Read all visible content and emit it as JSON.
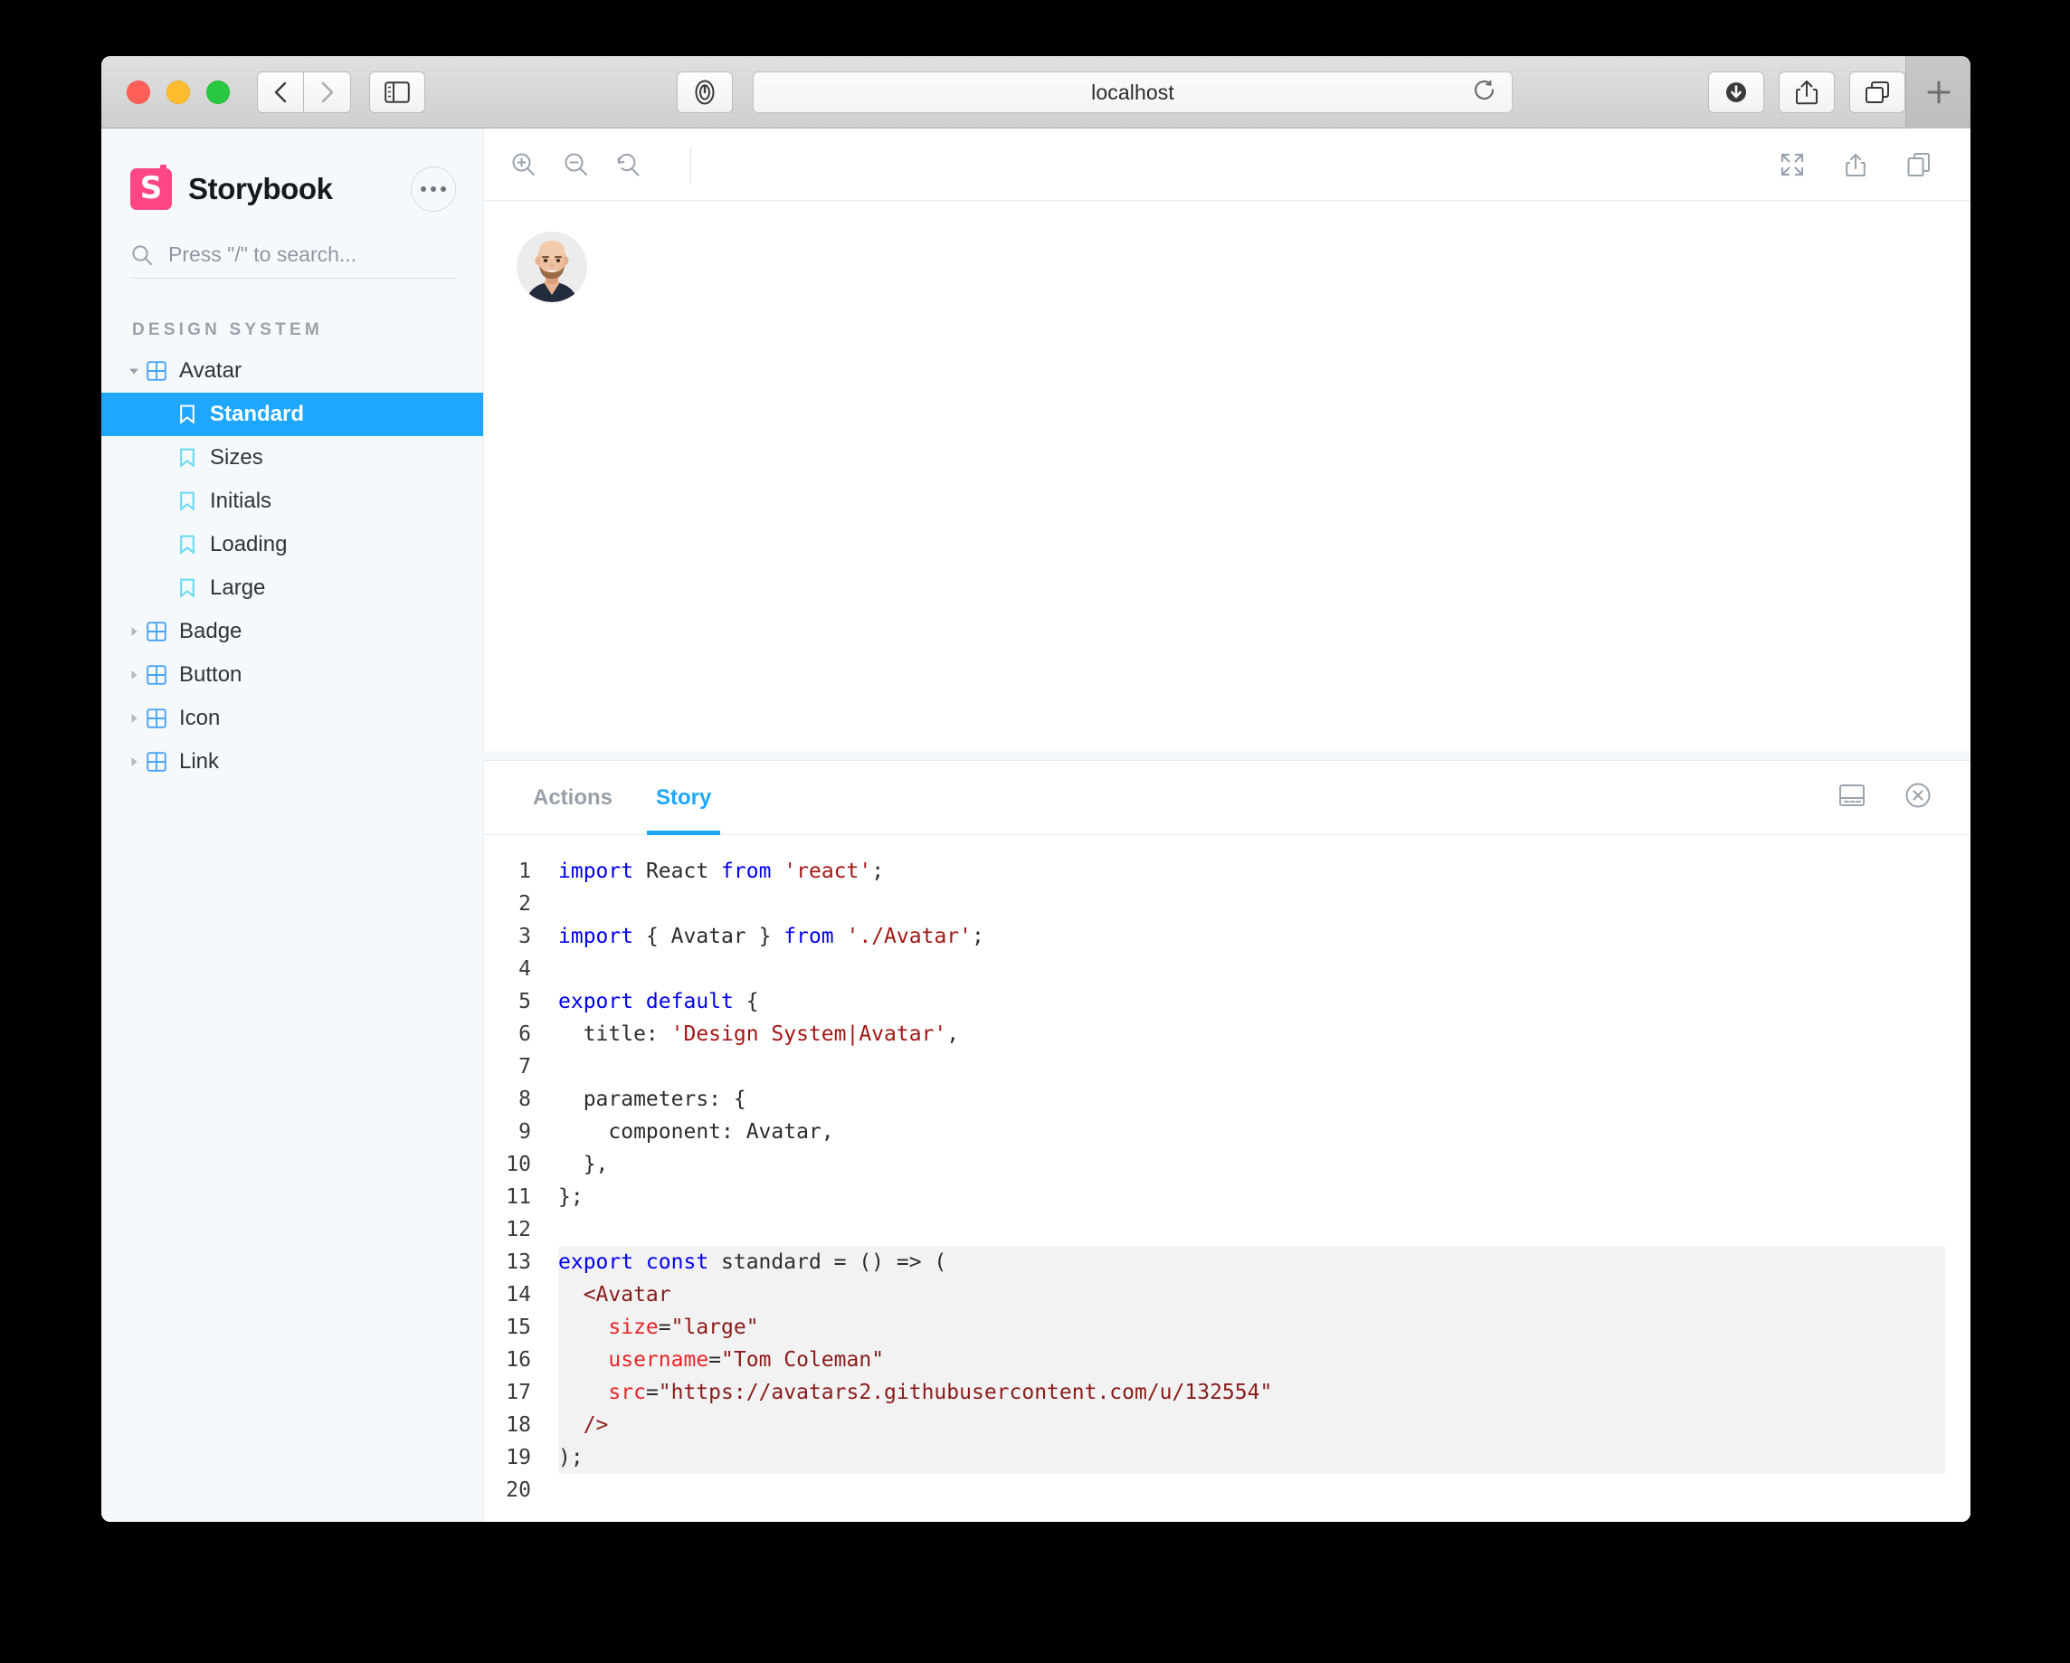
{
  "browser": {
    "url_text": "localhost",
    "traffic_lights": [
      "close",
      "minimize",
      "maximize"
    ],
    "nav_back_icon": "chevron-left-icon",
    "nav_forward_icon": "chevron-right-icon",
    "sidebar_toggle_icon": "sidebar-icon",
    "privacy_icon": "privacy-report-icon",
    "reload_icon": "reload-icon",
    "download_icon": "download-icon",
    "share_icon": "share-icon",
    "tab_overview_icon": "tab-overview-icon",
    "new_tab_label": "+"
  },
  "storybook": {
    "brand": "Storybook",
    "logo_icon": "storybook-logo-icon",
    "menu_icon": "ellipsis-icon",
    "search": {
      "placeholder": "Press \"/\" to search...",
      "icon": "search-icon"
    },
    "section_label": "DESIGN SYSTEM",
    "tree": [
      {
        "label": "Avatar",
        "type": "component",
        "expanded": true,
        "icon": "component-grid-icon",
        "caret": "caret-down-icon",
        "selected": false
      },
      {
        "label": "Standard",
        "type": "story",
        "icon": "bookmark-icon",
        "selected": true
      },
      {
        "label": "Sizes",
        "type": "story",
        "icon": "bookmark-icon",
        "selected": false
      },
      {
        "label": "Initials",
        "type": "story",
        "icon": "bookmark-icon",
        "selected": false
      },
      {
        "label": "Loading",
        "type": "story",
        "icon": "bookmark-icon",
        "selected": false
      },
      {
        "label": "Large",
        "type": "story",
        "icon": "bookmark-icon",
        "selected": false
      },
      {
        "label": "Badge",
        "type": "component",
        "expanded": false,
        "icon": "component-grid-icon",
        "caret": "caret-right-icon",
        "selected": false
      },
      {
        "label": "Button",
        "type": "component",
        "expanded": false,
        "icon": "component-grid-icon",
        "caret": "caret-right-icon",
        "selected": false
      },
      {
        "label": "Icon",
        "type": "component",
        "expanded": false,
        "icon": "component-grid-icon",
        "caret": "caret-right-icon",
        "selected": false
      },
      {
        "label": "Link",
        "type": "component",
        "expanded": false,
        "icon": "component-grid-icon",
        "caret": "caret-right-icon",
        "selected": false
      }
    ]
  },
  "canvas_toolbar": {
    "zoom_in_icon": "zoom-in-icon",
    "zoom_out_icon": "zoom-out-icon",
    "zoom_reset_icon": "zoom-reset-icon",
    "fullscreen_icon": "fullscreen-icon",
    "share_icon": "share-icon",
    "copy_icon": "copy-icon"
  },
  "canvas": {
    "avatar_alt": "Tom Coleman avatar"
  },
  "panel": {
    "tabs": [
      {
        "label": "Actions",
        "active": false
      },
      {
        "label": "Story",
        "active": true
      }
    ],
    "position_icon": "panel-position-icon",
    "close_icon": "close-circle-icon"
  },
  "code": {
    "highlight_start": 13,
    "highlight_end": 19,
    "lines": [
      {
        "n": "1",
        "tokens": [
          {
            "t": "import",
            "c": "kw"
          },
          {
            "t": " React ",
            "c": "pl"
          },
          {
            "t": "from",
            "c": "kw"
          },
          {
            "t": " ",
            "c": "pl"
          },
          {
            "t": "'react'",
            "c": "str"
          },
          {
            "t": ";",
            "c": "pl"
          }
        ]
      },
      {
        "n": "2",
        "tokens": []
      },
      {
        "n": "3",
        "tokens": [
          {
            "t": "import",
            "c": "kw"
          },
          {
            "t": " { Avatar } ",
            "c": "pl"
          },
          {
            "t": "from",
            "c": "kw"
          },
          {
            "t": " ",
            "c": "pl"
          },
          {
            "t": "'./Avatar'",
            "c": "str"
          },
          {
            "t": ";",
            "c": "pl"
          }
        ]
      },
      {
        "n": "4",
        "tokens": []
      },
      {
        "n": "5",
        "tokens": [
          {
            "t": "export default",
            "c": "kw"
          },
          {
            "t": " {",
            "c": "pl"
          }
        ]
      },
      {
        "n": "6",
        "tokens": [
          {
            "t": "  title: ",
            "c": "pl"
          },
          {
            "t": "'Design System|Avatar'",
            "c": "str"
          },
          {
            "t": ",",
            "c": "pl"
          }
        ]
      },
      {
        "n": "7",
        "tokens": []
      },
      {
        "n": "8",
        "tokens": [
          {
            "t": "  parameters: {",
            "c": "pl"
          }
        ]
      },
      {
        "n": "9",
        "tokens": [
          {
            "t": "    component: Avatar,",
            "c": "pl"
          }
        ]
      },
      {
        "n": "10",
        "tokens": [
          {
            "t": "  },",
            "c": "pl"
          }
        ]
      },
      {
        "n": "11",
        "tokens": [
          {
            "t": "};",
            "c": "pl"
          }
        ]
      },
      {
        "n": "12",
        "tokens": []
      },
      {
        "n": "13",
        "tokens": [
          {
            "t": "export const",
            "c": "kw"
          },
          {
            "t": " standard = () => (",
            "c": "pl"
          }
        ]
      },
      {
        "n": "14",
        "tokens": [
          {
            "t": "  <Avatar",
            "c": "tag"
          }
        ]
      },
      {
        "n": "15",
        "tokens": [
          {
            "t": "    size",
            "c": "attr"
          },
          {
            "t": "=",
            "c": "pl"
          },
          {
            "t": "\"large\"",
            "c": "str2"
          }
        ]
      },
      {
        "n": "16",
        "tokens": [
          {
            "t": "    username",
            "c": "attr"
          },
          {
            "t": "=",
            "c": "pl"
          },
          {
            "t": "\"Tom Coleman\"",
            "c": "str2"
          }
        ]
      },
      {
        "n": "17",
        "tokens": [
          {
            "t": "    src",
            "c": "attr"
          },
          {
            "t": "=",
            "c": "pl"
          },
          {
            "t": "\"https://avatars2.githubusercontent.com/u/132554\"",
            "c": "str2"
          }
        ]
      },
      {
        "n": "18",
        "tokens": [
          {
            "t": "  />",
            "c": "tag"
          }
        ]
      },
      {
        "n": "19",
        "tokens": [
          {
            "t": ");",
            "c": "pl"
          }
        ]
      },
      {
        "n": "20",
        "tokens": []
      }
    ]
  },
  "colors": {
    "accent_blue": "#1ea7fd",
    "brand_pink": "#ff4785",
    "sidebar_bg": "#f6f9fc",
    "string_red": "#a31515",
    "attr_red": "#e8252a",
    "keyword_blue": "#0000ee"
  }
}
